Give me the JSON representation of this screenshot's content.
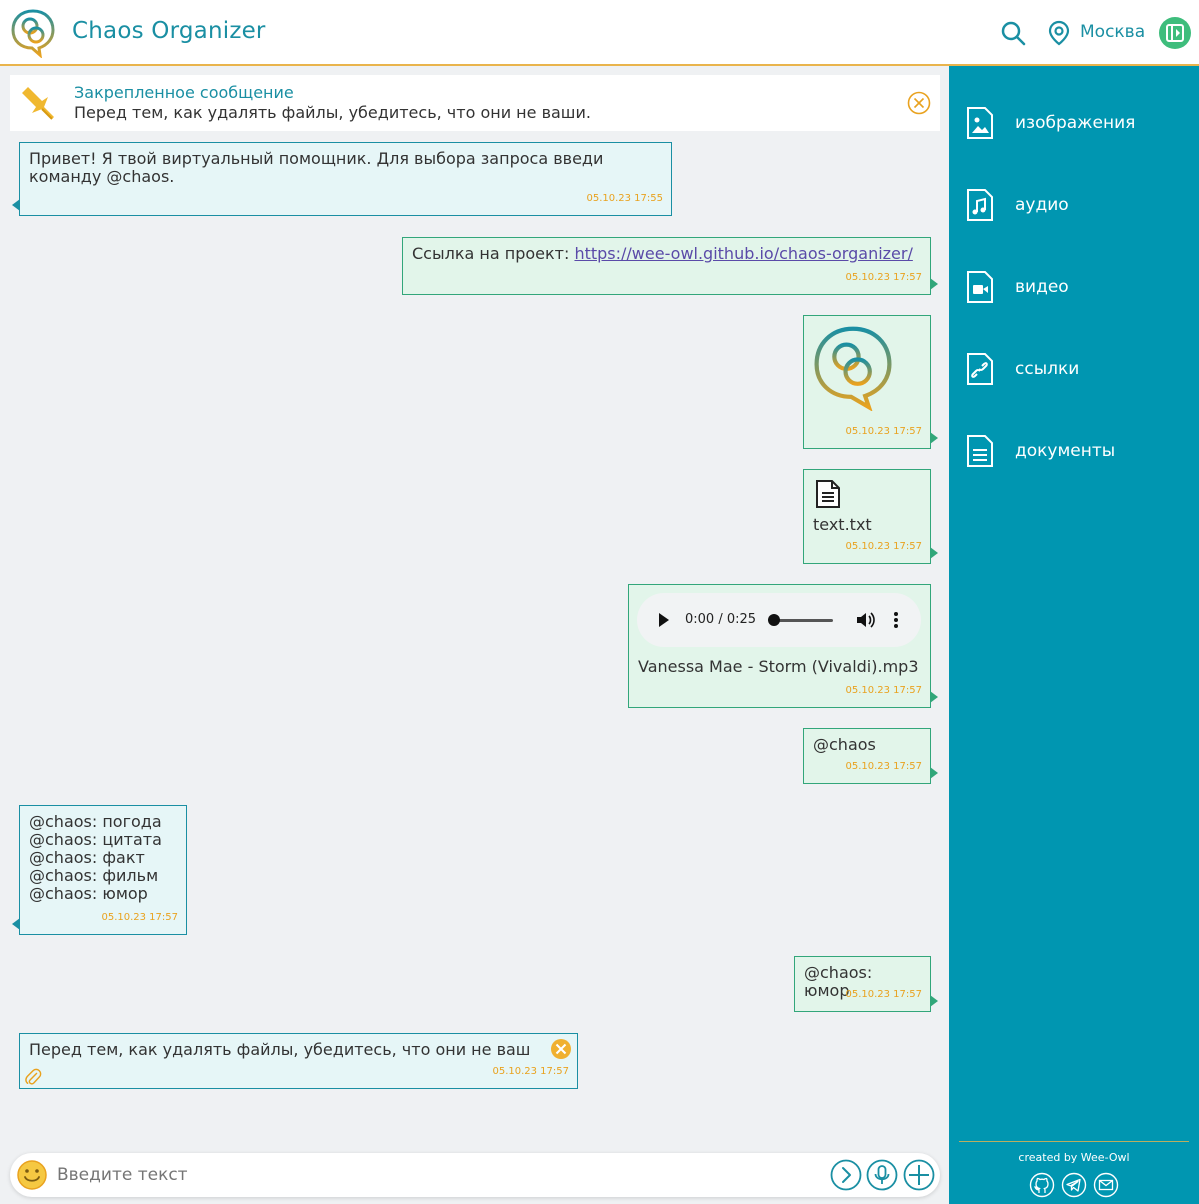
{
  "header": {
    "app_title": "Chaos Organizer",
    "city": "Москва",
    "icons": [
      "logo-icon",
      "search-icon",
      "location-icon",
      "panel-toggle-icon"
    ]
  },
  "pinned": {
    "title": "Закрепленное сообщение",
    "text": "Перед тем, как удалять файлы, убедитесь, что они не ваши."
  },
  "messages": [
    {
      "dir": "in",
      "line1": "Привет! Я твой виртуальный помощник. Для выбора запроса введи",
      "line2": "команду @chaos.",
      "time": "05.10.23 17:55"
    },
    {
      "dir": "out",
      "prefix": "Ссылка на проект: ",
      "link": "https://wee-owl.github.io/chaos-organizer/",
      "time": "05.10.23 17:57"
    },
    {
      "dir": "out",
      "kind": "image",
      "time": "05.10.23 17:57"
    },
    {
      "dir": "out",
      "kind": "file",
      "filename": "text.txt",
      "time": "05.10.23 17:57"
    },
    {
      "dir": "out",
      "kind": "audio",
      "audio_time": "0:00 / 0:25",
      "audio_progress": 0,
      "filename": "Vanessa Mae - Storm (Vivaldi).mp3",
      "time": "05.10.23 17:57"
    },
    {
      "dir": "out",
      "text": "@chaos",
      "time": "05.10.23 17:57"
    },
    {
      "dir": "in",
      "lines": [
        "@chaos: погода",
        "@chaos: цитата",
        "@chaos: факт",
        "@chaos: фильм",
        "@chaos: юмор"
      ],
      "time": "05.10.23 17:57"
    },
    {
      "dir": "out",
      "text": "@chaos: юмор",
      "time": "05.10.23 17:57"
    },
    {
      "dir": "in",
      "text": "Перед тем, как удалять файлы, убедитесь, что они не ваш",
      "time": "05.10.23 17:57"
    }
  ],
  "input": {
    "placeholder": "Введите текст"
  },
  "sidebar": {
    "items": [
      {
        "label": "изображения",
        "icon": "image-file-icon"
      },
      {
        "label": "аудио",
        "icon": "audio-file-icon"
      },
      {
        "label": "видео",
        "icon": "video-file-icon"
      },
      {
        "label": "ссылки",
        "icon": "link-file-icon"
      },
      {
        "label": "документы",
        "icon": "document-file-icon"
      }
    ],
    "created": "created by Wee-Owl",
    "social": [
      "github-icon",
      "telegram-icon",
      "mail-icon"
    ]
  },
  "colors": {
    "accent": "#1a8fa3",
    "sidebar": "#0096b1",
    "gold": "#e9b44c",
    "incoming_bg": "#e6f6f7",
    "outgoing_bg": "#e2f5ea"
  }
}
